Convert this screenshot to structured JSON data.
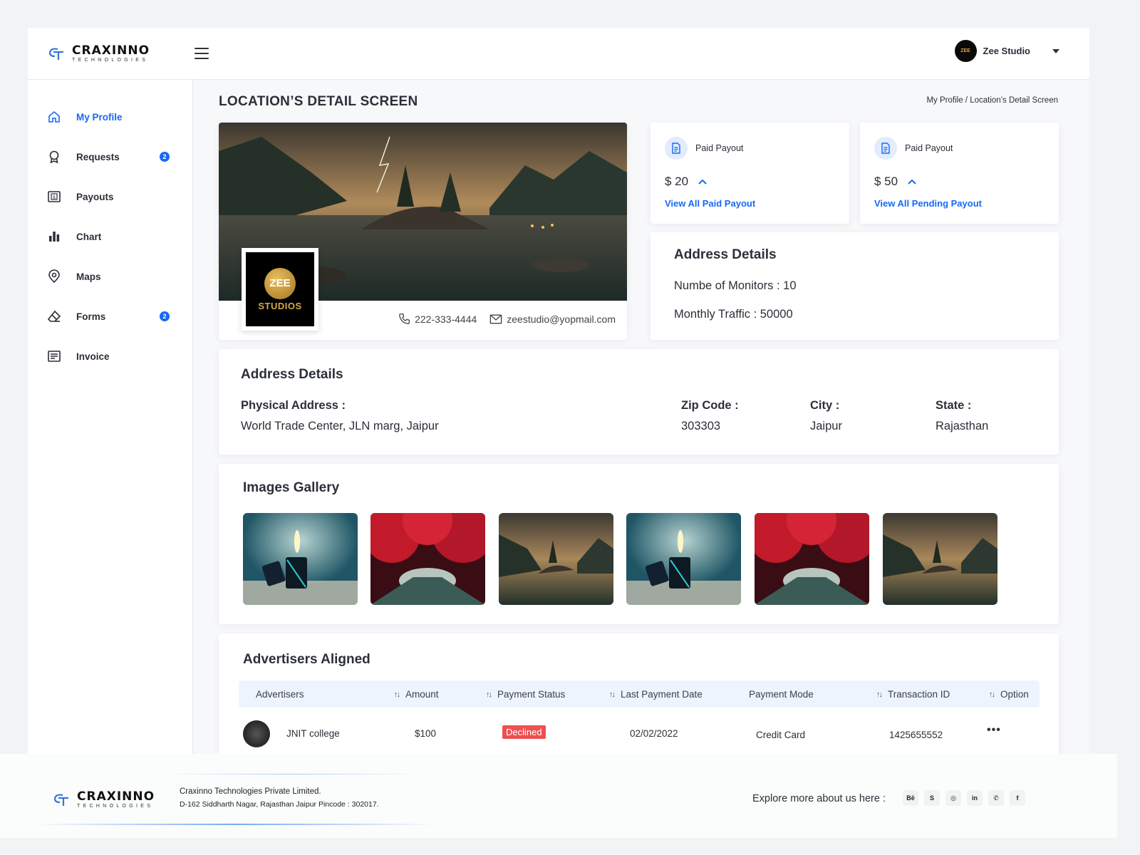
{
  "brand": {
    "name": "CRAXINNO",
    "tagline": "TECHNOLOGIES"
  },
  "user": {
    "name": "Zee Studio",
    "avatar_text": "ZEE"
  },
  "sidebar": {
    "items": [
      {
        "label": "My Profile",
        "icon": "home-icon",
        "active": true
      },
      {
        "label": "Requests",
        "icon": "award-icon",
        "badge": "2"
      },
      {
        "label": "Payouts",
        "icon": "dollar-bill-icon"
      },
      {
        "label": "Chart",
        "icon": "bar-chart-icon"
      },
      {
        "label": "Maps",
        "icon": "map-pin-icon"
      },
      {
        "label": "Forms",
        "icon": "eraser-icon",
        "badge": "2"
      },
      {
        "label": "Invoice",
        "icon": "document-lines-icon"
      }
    ]
  },
  "page": {
    "title": "LOCATION’S DETAIL SCREEN",
    "breadcrumb": {
      "home": "My Profile",
      "sep": " / ",
      "current": "Location’s Detail Screen"
    }
  },
  "hero": {
    "logo_top": "ZEE",
    "logo_bottom": "STUDIOS",
    "phone": "222-333-4444",
    "email": "zeestudio@yopmail.com"
  },
  "payouts": [
    {
      "label": "Paid Payout",
      "amount": "$ 20",
      "link": "View All Paid Payout"
    },
    {
      "label": "Paid Payout",
      "amount": "$ 50",
      "link": "View All Pending Payout"
    }
  ],
  "address_summary": {
    "title": "Address Details",
    "monitors": "Numbe of Monitors : 10",
    "traffic": "Monthly Traffic : 50000"
  },
  "address_full": {
    "title": "Address Details",
    "physical_label": "Physical Address :",
    "physical_value": "World Trade Center, JLN marg, Jaipur",
    "zip_label": "Zip Code :",
    "zip_value": "303303",
    "city_label": "City :",
    "city_value": "Jaipur",
    "state_label": "State :",
    "state_value": "Rajasthan"
  },
  "gallery": {
    "title": "Images Gallery",
    "images": [
      "lighter",
      "red-forest",
      "lake-mountain",
      "lighter",
      "red-forest",
      "lake-mountain"
    ]
  },
  "advertisers": {
    "title": "Advertisers Aligned",
    "columns": [
      "Advertisers",
      "Amount",
      "Payment Status",
      "Last Payment Date",
      "Payment Mode",
      "Transaction ID",
      "Option"
    ],
    "rows": [
      {
        "name": "JNIT college",
        "amount": "$100",
        "status": "Declined",
        "date": "02/02/2022",
        "mode": "Credit Card",
        "txn": "1425655552",
        "option": "•••"
      }
    ]
  },
  "footer": {
    "company": "Craxinno Technologies Private Limited.",
    "address": "D-162 Siddharth Nagar, Rajasthan Jaipur Pincode : 302017.",
    "explore": "Explore more about us here :",
    "socials": [
      "behance-icon",
      "skype-icon",
      "instagram-icon",
      "linkedin-icon",
      "whatsapp-icon",
      "facebook-icon"
    ],
    "social_glyphs": [
      "Bē",
      "S",
      "◎",
      "in",
      "✆",
      "f"
    ]
  },
  "colors": {
    "accent": "#1669f5",
    "declined": "#ef4f4f",
    "table_head": "#eef4fe"
  }
}
